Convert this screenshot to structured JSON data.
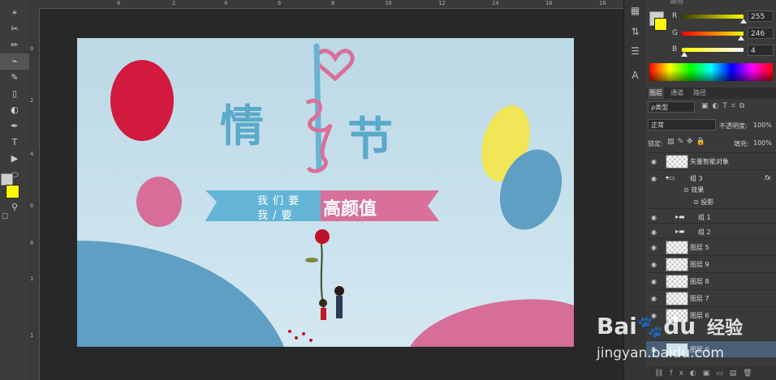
{
  "rulers": {
    "top": [
      "0",
      "2",
      "4",
      "6",
      "8",
      "10",
      "12",
      "14",
      "16",
      "18"
    ],
    "left": [
      "0",
      "2",
      "4",
      "6",
      "8",
      "1",
      "1"
    ]
  },
  "toolbar": {
    "tools": [
      "⌖",
      "✂",
      "✏",
      "⌁",
      "✎",
      "▯",
      "◐",
      "✒",
      "T",
      "▶",
      "⬭",
      "✋",
      "⚲"
    ]
  },
  "artboard": {
    "title_left": "情",
    "title_right": "节",
    "banner_line1": "我 们 要",
    "banner_line2": "我 / 要",
    "banner_highlight": "高颜值",
    "colors": {
      "red": "#d11a3d",
      "pink": "#d66e98",
      "yellow": "#f0e658",
      "blue": "#5e9fc3",
      "title_blue": "#5aa9c9",
      "banner_blue": "#63b4d6",
      "banner_pink": "#d8709a"
    }
  },
  "color_panel": {
    "header": "颜色",
    "r_label": "R",
    "r_value": "255",
    "g_label": "G",
    "g_value": "246",
    "b_label": "B",
    "b_value": "4",
    "fg_color": "#fff604",
    "bg_color": "#cfcfcf"
  },
  "layers_panel": {
    "tabs": [
      "图层",
      "通道",
      "路径"
    ],
    "filter_label": "ρ类型",
    "blend_mode": "正常",
    "opacity_label": "不透明度:",
    "opacity_value": "100%",
    "lock_label": "锁定:",
    "fill_label": "填充:",
    "fill_value": "100%",
    "layers": [
      {
        "name": "矢量智能对象",
        "type": "smart"
      },
      {
        "name": "组 3",
        "type": "group-open",
        "fx": "fx"
      },
      {
        "name": "效果",
        "type": "effect"
      },
      {
        "name": "投影",
        "type": "effect-sub"
      },
      {
        "name": "组 1",
        "type": "group"
      },
      {
        "name": "组 2",
        "type": "group"
      },
      {
        "name": "图层 5",
        "type": "layer"
      },
      {
        "name": "图层 9",
        "type": "layer"
      },
      {
        "name": "图层 8",
        "type": "layer"
      },
      {
        "name": "图层 7",
        "type": "layer"
      },
      {
        "name": "图层 6",
        "type": "layer"
      },
      {
        "name": "图层 0",
        "type": "layer"
      }
    ]
  },
  "watermark": {
    "brand": "Bai",
    "brand2": "du",
    "brand_cn": "经验",
    "url": "jingyan.baidu.com"
  }
}
